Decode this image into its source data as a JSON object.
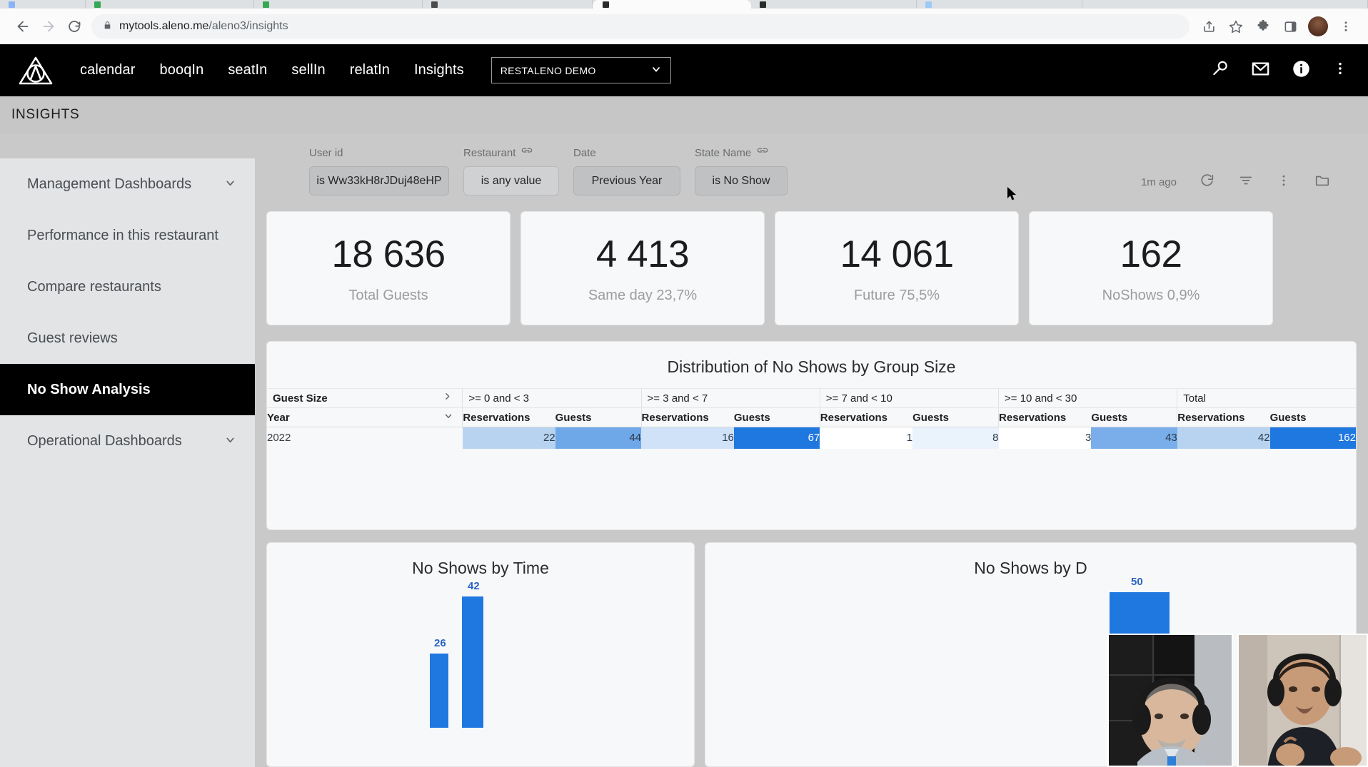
{
  "browser": {
    "url_host": "mytools.aleno.me",
    "url_path": "/aleno3/insights",
    "back_icon": "back-arrow-icon",
    "forward_icon": "forward-arrow-icon",
    "reload_icon": "reload-icon",
    "lock_icon": "lock-icon",
    "share_icon": "share-icon",
    "bookmark_icon": "star-icon",
    "extensions_icon": "puzzle-icon",
    "sidepanel_icon": "side-panel-icon",
    "profile_icon": "avatar-icon",
    "menu_icon": "kebab-menu-icon"
  },
  "appnav": {
    "logo_name": "aleno-logo",
    "links": [
      {
        "label": "calendar"
      },
      {
        "label": "booqIn"
      },
      {
        "label": "seatIn"
      },
      {
        "label": "sellIn"
      },
      {
        "label": "relatIn"
      },
      {
        "label": "Insights"
      }
    ],
    "org_select": "RESTALENO DEMO",
    "org_caret": "chevron-down-icon",
    "right_icons": [
      {
        "name": "search-icon"
      },
      {
        "name": "mail-icon"
      },
      {
        "name": "info-icon"
      },
      {
        "name": "kebab-menu-icon"
      }
    ]
  },
  "page_header": {
    "title": "INSIGHTS"
  },
  "sidebar": {
    "items": [
      {
        "label": "Management Dashboards",
        "expandable": true,
        "active": false
      },
      {
        "label": "Performance in this restaurant",
        "expandable": false,
        "active": false
      },
      {
        "label": "Compare restaurants",
        "expandable": false,
        "active": false
      },
      {
        "label": "Guest reviews",
        "expandable": false,
        "active": false
      },
      {
        "label": "No Show Analysis",
        "expandable": false,
        "active": true
      },
      {
        "label": "Operational Dashboards",
        "expandable": true,
        "active": false
      }
    ]
  },
  "filters": [
    {
      "label": "User id",
      "value": "is Ww33kH8rJDuj48eHP",
      "linked": false,
      "style": "filled"
    },
    {
      "label": "Restaurant",
      "value": "is any value",
      "linked": true,
      "style": "outline"
    },
    {
      "label": "Date",
      "value": "Previous Year",
      "linked": false,
      "style": "filled"
    },
    {
      "label": "State Name",
      "value": "is No Show",
      "linked": true,
      "style": "filled"
    }
  ],
  "dashboard_tools": {
    "updated": "1m ago",
    "icons": [
      {
        "name": "refresh-icon"
      },
      {
        "name": "filter-icon"
      },
      {
        "name": "kebab-menu-icon"
      },
      {
        "name": "folder-icon"
      }
    ]
  },
  "kpis": [
    {
      "value": "18 636",
      "caption": "Total Guests"
    },
    {
      "value": "4 413",
      "caption": "Same day 23,7%"
    },
    {
      "value": "14 061",
      "caption": "Future 75,5%"
    },
    {
      "value": "162",
      "caption": "NoShows 0,9%"
    }
  ],
  "distribution": {
    "title": "Distribution of No Shows by Group Size",
    "row_dim_label": "Guest Size",
    "row_dim_expand_icon": "chevron-right-icon",
    "row_field_label": "Year",
    "row_field_sort_icon": "chevron-down-icon",
    "groups": [
      ">= 0 and < 3",
      ">= 3 and < 7",
      ">= 7 and < 10",
      ">= 10 and < 30",
      "Total"
    ],
    "measures": [
      "Reservations",
      "Guests"
    ],
    "rows": [
      {
        "year": "2022",
        "cells": [
          {
            "value": "22",
            "shade": "#b7d3f0"
          },
          {
            "value": "44",
            "shade": "#6fa8e8"
          },
          {
            "value": "16",
            "shade": "#cfe2f7"
          },
          {
            "value": "67",
            "shade": "#1f77e0"
          },
          {
            "value": "1",
            "shade": "#ffffff"
          },
          {
            "value": "8",
            "shade": "#eaf2fc"
          },
          {
            "value": "3",
            "shade": "#ffffff"
          },
          {
            "value": "43",
            "shade": "#79aeea"
          },
          {
            "value": "42",
            "shade": "#b7d3f0"
          },
          {
            "value": "162",
            "shade": "#1f77e0"
          }
        ]
      }
    ]
  },
  "chart_data": [
    {
      "type": "bar",
      "title": "No Shows by Time",
      "categories": [
        "",
        ""
      ],
      "values": [
        26,
        42
      ],
      "labels": [
        "26",
        "42"
      ],
      "ylim": [
        0,
        46
      ],
      "bar_color": "#1f77e0",
      "xlabel": "",
      "ylabel": "",
      "grid": false
    },
    {
      "type": "bar",
      "title": "No Shows by D",
      "categories": [
        ""
      ],
      "values": [
        50
      ],
      "labels": [
        "50"
      ],
      "ylim": [
        0,
        55
      ],
      "bar_color": "#1f77e0",
      "xlabel": "",
      "ylabel": "",
      "grid": false
    }
  ],
  "webcams": [
    {
      "name": "presenter-left"
    },
    {
      "name": "presenter-right"
    }
  ]
}
